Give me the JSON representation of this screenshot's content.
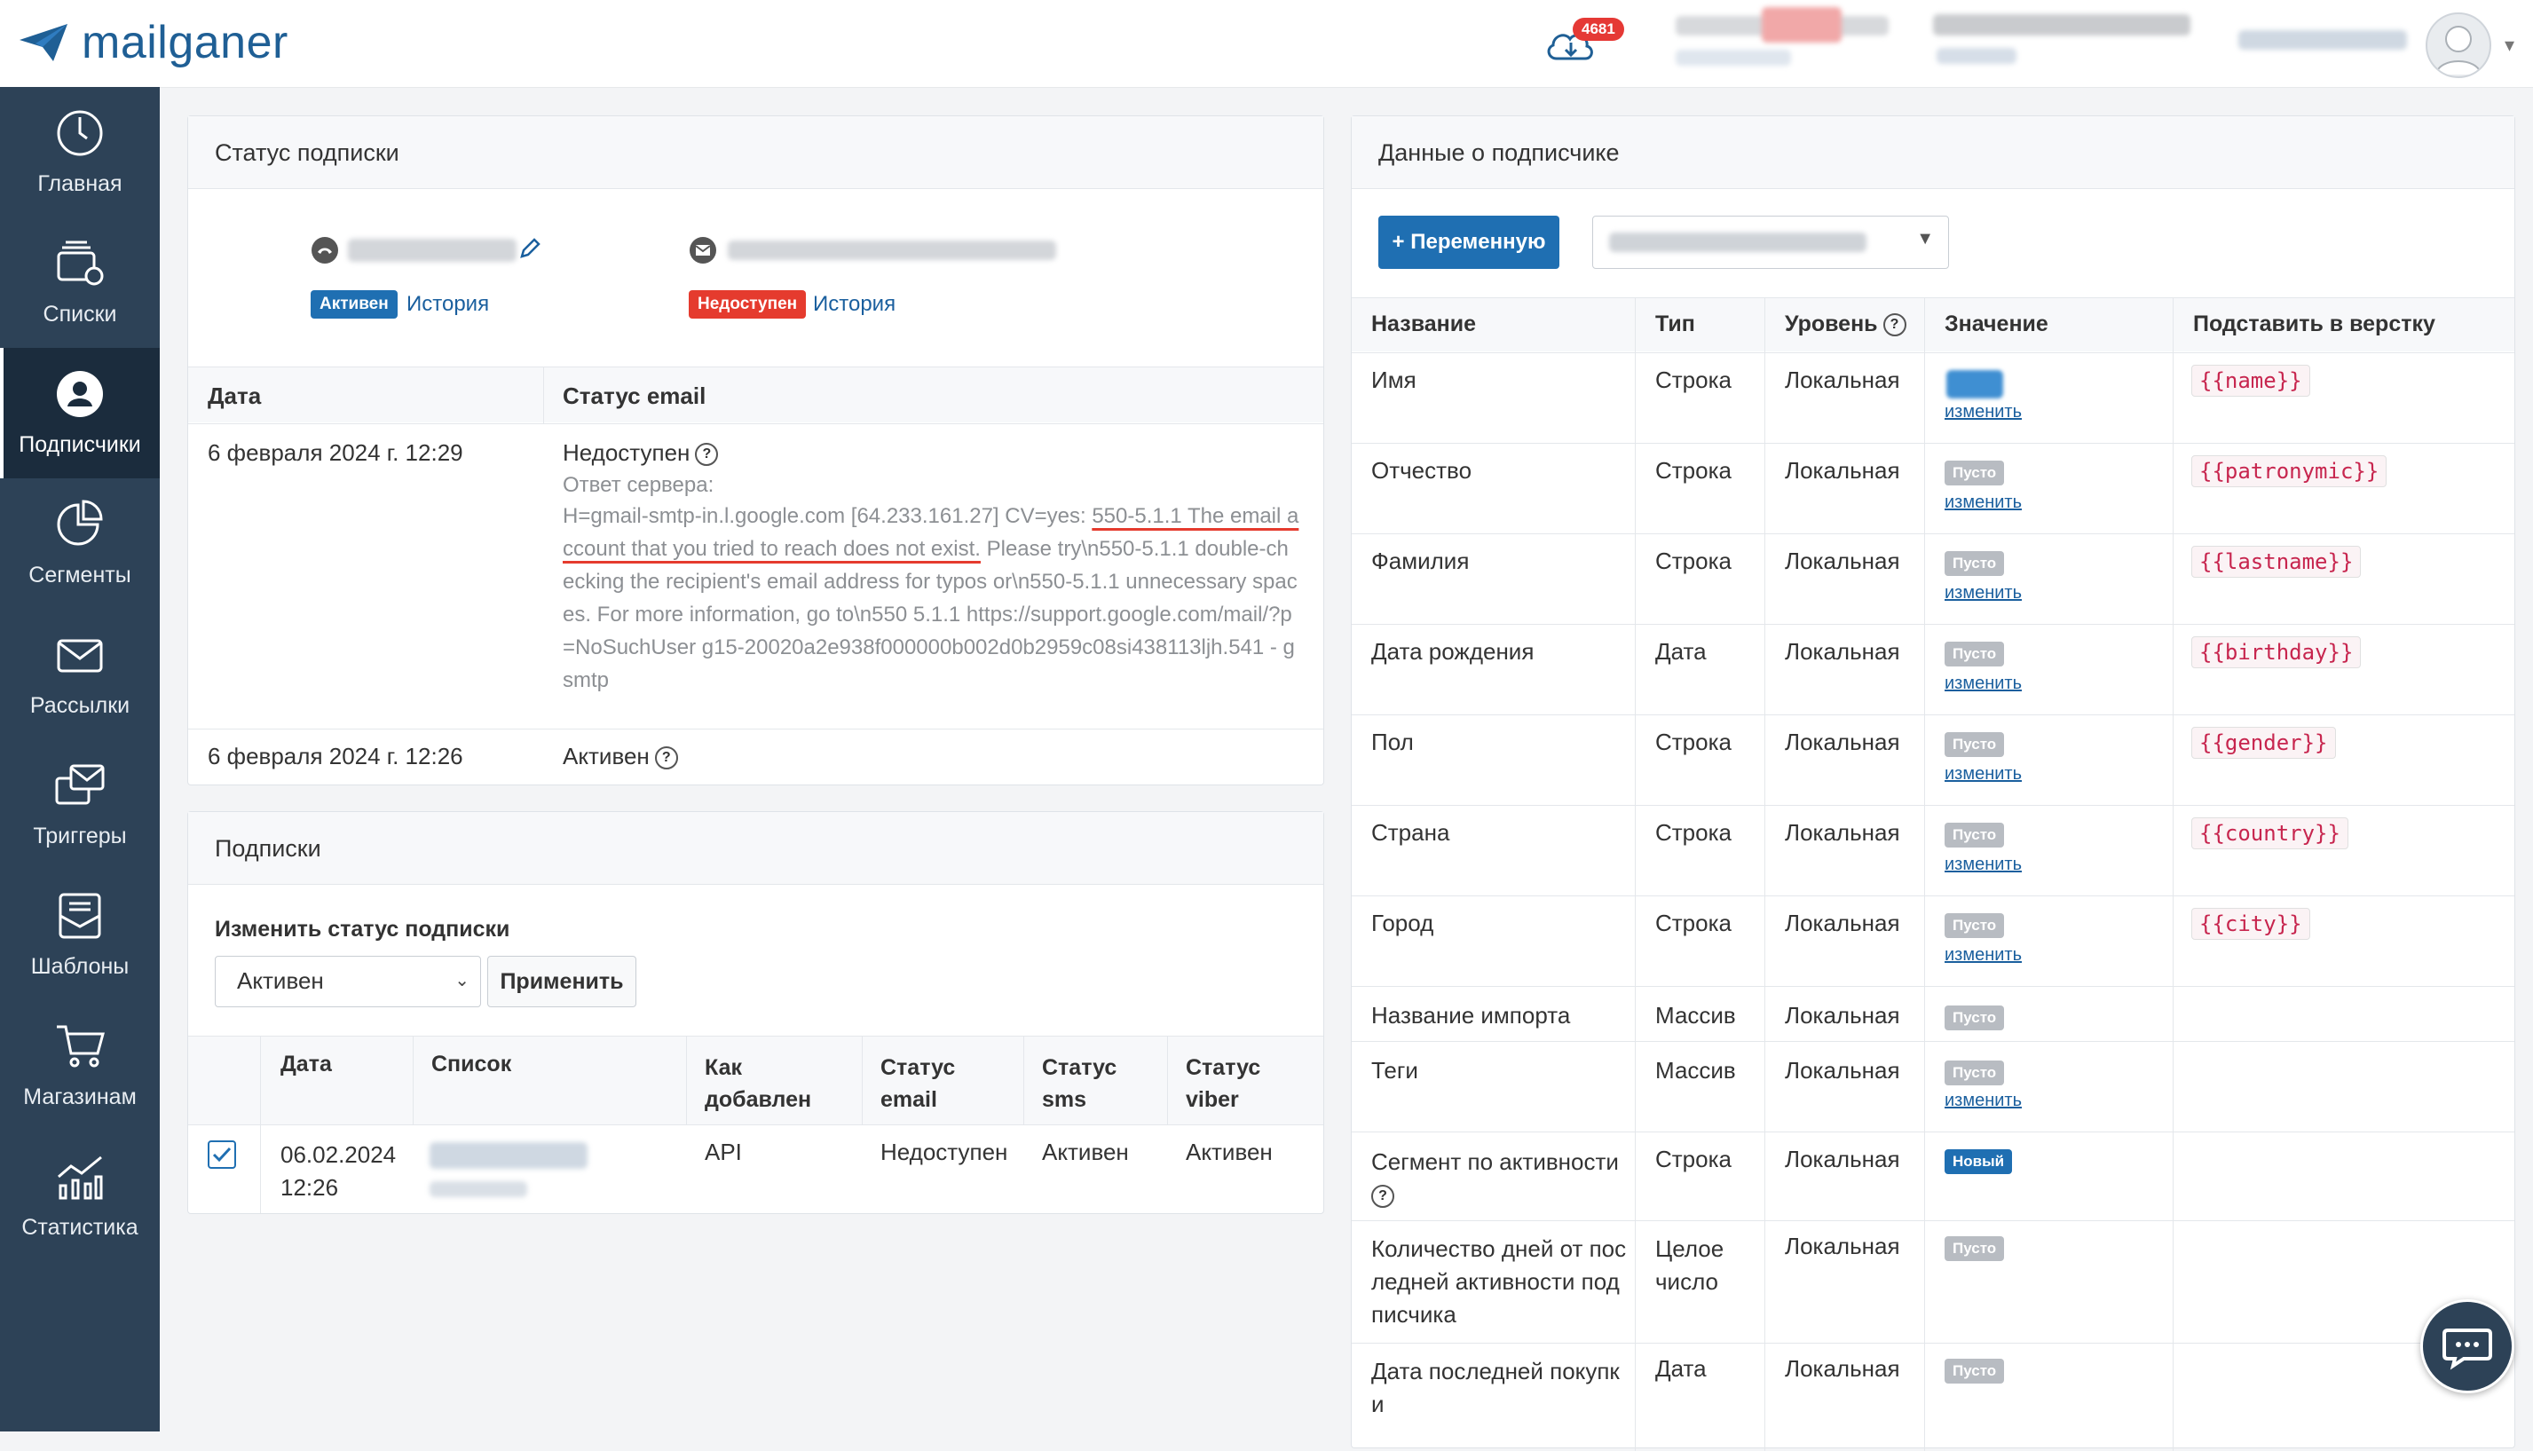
{
  "app": {
    "logo_text": "mailganer",
    "brand_color": "#1f5f95",
    "sidebar_color": "#2d4257"
  },
  "header": {
    "download_badge": "4681"
  },
  "sidebar": {
    "items": [
      {
        "label": "Главная",
        "icon": "dashboard-gauge-icon"
      },
      {
        "label": "Списки",
        "icon": "lists-icon"
      },
      {
        "label": "Подписчики",
        "icon": "subscriber-icon",
        "active": true
      },
      {
        "label": "Сегменты",
        "icon": "segments-pie-icon"
      },
      {
        "label": "Рассылки",
        "icon": "envelope-icon"
      },
      {
        "label": "Триггеры",
        "icon": "triggers-icon"
      },
      {
        "label": "Шаблоны",
        "icon": "templates-icon"
      },
      {
        "label": "Магазинам",
        "icon": "cart-icon"
      },
      {
        "label": "Статистика",
        "icon": "stats-chart-icon"
      }
    ]
  },
  "status_panel": {
    "title": "Статус подписки",
    "phone_badge": "Активен",
    "phone_history": "История",
    "email_badge": "Недоступен",
    "email_history": "История",
    "columns": {
      "date": "Дата",
      "status": "Статус email"
    },
    "rows": [
      {
        "date": "6 февраля 2024 г. 12:29",
        "status": "Недоступен",
        "server_label": "Ответ сервера:",
        "server_pre": "H=gmail-smtp-in.l.google.com [64.233.161.27] CV=yes: ",
        "server_highlight": "550-5.1.1 The email account that you tried to reach does not exist.",
        "server_post": " Please try\\n550-5.1.1 double-checking the recipient's email address for typos or\\n550-5.1.1 unnecessary spaces. For more information, go to\\n550 5.1.1 https://support.google.com/mail/?p=NoSuchUser g15-20020a2e938f000000b002d0b2959c08si438113ljh.541 - gsmtp"
      },
      {
        "date": "6 февраля 2024 г. 12:26",
        "status": "Активен"
      }
    ]
  },
  "subscriptions_panel": {
    "title": "Подписки",
    "change_label": "Изменить статус подписки",
    "select_value": "Активен",
    "apply_button": "Применить",
    "columns": [
      "Дата",
      "Список",
      "Как добавлен",
      "Статус email",
      "Статус sms",
      "Статус viber"
    ],
    "col_how_1": "Как",
    "col_how_2": "добавлен",
    "col_email_1": "Статус",
    "col_email_2": "email",
    "col_sms_1": "Статус",
    "col_sms_2": "sms",
    "col_viber_1": "Статус",
    "col_viber_2": "viber",
    "row": {
      "date_1": "06.02.2024",
      "date_2": "12:26",
      "how": "API",
      "email": "Недоступен",
      "sms": "Активен",
      "viber": "Активен",
      "checked": true
    }
  },
  "data_panel": {
    "title": "Данные о подписчике",
    "add_var_button": "+ Переменную",
    "columns": {
      "name": "Название",
      "type": "Тип",
      "level": "Уровень",
      "value": "Значение",
      "subst": "Подставить в верстку"
    },
    "edit_link": "изменить",
    "empty_badge": "Пусто",
    "new_badge": "Новый",
    "rows": [
      {
        "name": "Имя",
        "type": "Строка",
        "level": "Локальная",
        "value": "blurred",
        "code": "{{name}}"
      },
      {
        "name": "Отчество",
        "type": "Строка",
        "level": "Локальная",
        "value": "Пусто",
        "code": "{{patronymic}}"
      },
      {
        "name": "Фамилия",
        "type": "Строка",
        "level": "Локальная",
        "value": "Пусто",
        "code": "{{lastname}}"
      },
      {
        "name": "Дата рождения",
        "type": "Дата",
        "level": "Локальная",
        "value": "Пусто",
        "code": "{{birthday}}"
      },
      {
        "name": "Пол",
        "type": "Строка",
        "level": "Локальная",
        "value": "Пусто",
        "code": "{{gender}}"
      },
      {
        "name": "Страна",
        "type": "Строка",
        "level": "Локальная",
        "value": "Пусто",
        "code": "{{country}}"
      },
      {
        "name": "Город",
        "type": "Строка",
        "level": "Локальная",
        "value": "Пусто",
        "code": "{{city}}"
      },
      {
        "name": "Название импорта",
        "type": "Массив",
        "level": "Локальная",
        "value": "Пусто"
      },
      {
        "name": "Теги",
        "type": "Массив",
        "level": "Локальная",
        "value": "Пусто"
      },
      {
        "name": "Сегмент по активности",
        "type": "Строка",
        "level": "Локальная",
        "value": "Новый"
      },
      {
        "name_1": "Количество дней от пос",
        "name_2": "ледней активности под",
        "name_3": "писчика",
        "type_1": "Целое",
        "type_2": "число",
        "level": "Локальная",
        "value": "Пусто"
      },
      {
        "name_1": "Дата последней покупк",
        "name_2": "и",
        "type": "Дата",
        "level": "Локальная",
        "value": "Пусто"
      }
    ]
  }
}
